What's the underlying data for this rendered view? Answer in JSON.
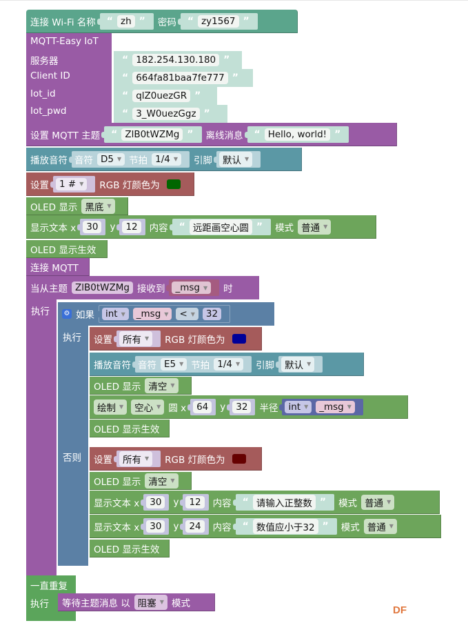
{
  "wifi": {
    "label": "连接 Wi-Fi 名称",
    "ssid": "zh",
    "pwd_label": "密码",
    "pwd": "zy1567"
  },
  "mqtt": {
    "title": "MQTT-Easy IoT",
    "server_label": "服务器",
    "server": "182.254.130.180",
    "client_label": "Client ID",
    "client": "664fa81baa7fe777",
    "iotid_label": "Iot_id",
    "iotid": "qlZ0uezGR",
    "iotpwd_label": "Iot_pwd",
    "iotpwd": "3_W0uezGgz"
  },
  "topic": {
    "label": "设置 MQTT 主题",
    "value": "ZlB0tWZMg",
    "offline_label": "离线消息",
    "offline": "Hello, world!"
  },
  "tone1": {
    "label": "播放音符",
    "note_label": "音符",
    "note": "D5",
    "beat_label": "节拍",
    "beat": "1/4",
    "pin_label": "引脚",
    "pin": "默认"
  },
  "rgb1": {
    "label": "设置",
    "target": "1 #",
    "suffix": "RGB 灯颜色为",
    "color": "#006600"
  },
  "oled1": {
    "label": "OLED 显示",
    "mode": "黑底"
  },
  "text1": {
    "label": "显示文本 x",
    "x": "30",
    "y_label": "y",
    "y": "12",
    "content_label": "内容",
    "content": "远距画空心圆",
    "mode_label": "模式",
    "mode": "普通"
  },
  "oled_show1": {
    "label": "OLED 显示生效"
  },
  "connect": {
    "label": "连接 MQTT"
  },
  "onmsg": {
    "label": "当从主题",
    "topic": "ZlB0tWZMg",
    "recv_label": "接收到",
    "var": "_msg",
    "suffix": "时",
    "exec": "执行"
  },
  "if": {
    "label": "如果",
    "cast": "int",
    "var": "_msg",
    "op": "<",
    "value": "32",
    "exec": "执行",
    "else": "否则"
  },
  "rgb2": {
    "label": "设置",
    "target": "所有",
    "suffix": "RGB 灯颜色为",
    "color": "#000099"
  },
  "tone2": {
    "label": "播放音符",
    "note_label": "音符",
    "note": "E5",
    "beat_label": "节拍",
    "beat": "1/4",
    "pin_label": "引脚",
    "pin": "默认"
  },
  "oled2": {
    "label": "OLED 显示",
    "mode": "清空"
  },
  "circle": {
    "draw": "绘制",
    "fill": "空心",
    "shape": "圆 x",
    "x": "64",
    "y_label": "y",
    "y": "32",
    "r_label": "半径",
    "cast": "int",
    "var": "_msg"
  },
  "oled_show2": {
    "label": "OLED 显示生效"
  },
  "rgb3": {
    "label": "设置",
    "target": "所有",
    "suffix": "RGB 灯颜色为",
    "color": "#660000"
  },
  "oled3": {
    "label": "OLED 显示",
    "mode": "清空"
  },
  "text2": {
    "label": "显示文本 x",
    "x": "30",
    "y_label": "y",
    "y": "12",
    "content_label": "内容",
    "content": "请输入正整数",
    "mode_label": "模式",
    "mode": "普通"
  },
  "text3": {
    "label": "显示文本 x",
    "x": "30",
    "y_label": "y",
    "y": "24",
    "content_label": "内容",
    "content": "数值应小于32",
    "mode_label": "模式",
    "mode": "普通"
  },
  "oled_show3": {
    "label": "OLED 显示生效"
  },
  "loop": {
    "label": "一直重复",
    "exec": "执行"
  },
  "wait": {
    "label": "等待主题消息 以",
    "mode": "阻塞",
    "suffix": "模式"
  },
  "watermark": "DF"
}
